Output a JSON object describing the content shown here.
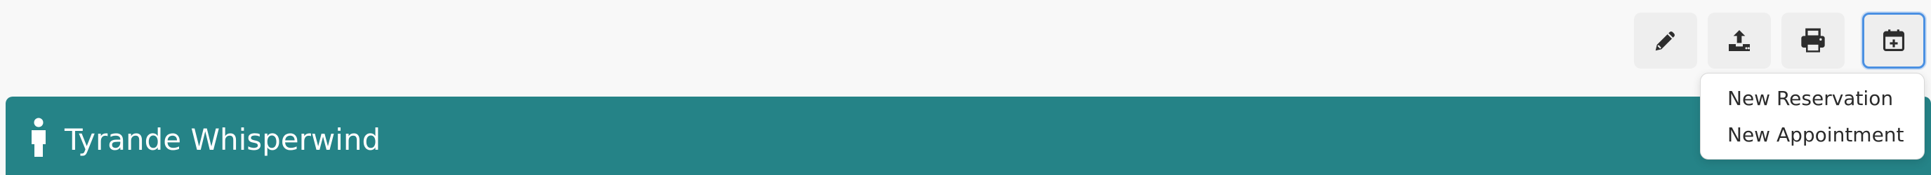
{
  "toolbar": {
    "buttons": [
      {
        "name": "edit",
        "icon": "pencil-icon"
      },
      {
        "name": "export",
        "icon": "upload-icon"
      },
      {
        "name": "print",
        "icon": "printer-icon"
      },
      {
        "name": "add-to-calendar",
        "icon": "calendar-plus-icon",
        "active": true
      }
    ]
  },
  "header": {
    "icon": "person-icon",
    "name": "Tyrande Whisperwind",
    "color": "#258387"
  },
  "dropdown": {
    "items": [
      {
        "label": "New Reservation"
      },
      {
        "label": "New Appointment"
      }
    ]
  },
  "colors": {
    "accent": "#258387",
    "focus_ring": "#4a90e2",
    "background": "#f8f8f8"
  }
}
